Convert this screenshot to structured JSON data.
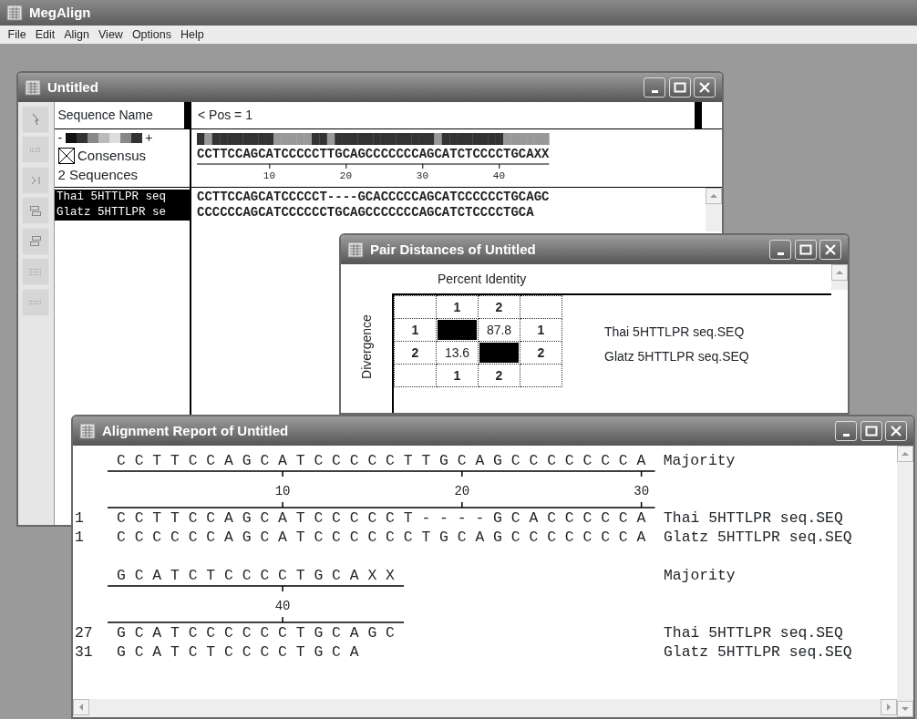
{
  "app": {
    "title": "MegAlign",
    "menu": [
      "File",
      "Edit",
      "Align",
      "View",
      "Options",
      "Help"
    ]
  },
  "alignment_window": {
    "title": "Untitled",
    "name_header": "Sequence Name",
    "position_header": "< Pos = 1",
    "scale_minus": "-",
    "scale_plus": "+",
    "consensus": {
      "checked": true,
      "label": "Consensus",
      "count": "2 Sequences",
      "sequence": "CCTTCCAGCATCCCCCTTGCAGCCCCCCCAGCATCTCCCCTGCAXX",
      "ruler": [
        "10",
        "20",
        "30",
        "40"
      ]
    },
    "sequences": [
      {
        "name": "Thai 5HTTLPR seq",
        "residues": "CCTTCCAGCATCCCCCT----GCACCCCCAGCATCCCCCCTGCAGC",
        "selected": true
      },
      {
        "name": "Glatz 5HTTLPR se",
        "residues": "CCCCCCAGCATCCCCCCTGCAGCCCCCCCAGCATCTCCCCTGCA",
        "selected": true
      }
    ]
  },
  "pair_distances": {
    "title": "Pair Distances of Untitled",
    "top_label": "Percent Identity",
    "side_label": "Divergence",
    "column_headers": [
      "1",
      "2"
    ],
    "column_footers": [
      "1",
      "2"
    ],
    "rows": [
      {
        "label": "1",
        "cells": [
          {
            "kind": "filled"
          },
          {
            "kind": "value",
            "text": "87.8"
          }
        ],
        "end_label": "1",
        "name": "Thai 5HTTLPR seq.SEQ"
      },
      {
        "label": "2",
        "cells": [
          {
            "kind": "value",
            "text": "13.6"
          },
          {
            "kind": "filled"
          }
        ],
        "end_label": "2",
        "name": "Glatz 5HTTLPR seq.SEQ"
      }
    ]
  },
  "report": {
    "title": "Alignment Report of Untitled",
    "blocks": [
      {
        "majority": "C C T T C C A G C A T C C C C C T T G C A G C C C C C C C A",
        "majority_label": "Majority",
        "ruler": [
          "10",
          "20",
          "30"
        ],
        "rows": [
          {
            "number": "1",
            "residues": "C C T T C C A G C A T C C C C C T - - - - G C A C C C C C A",
            "name": "Thai 5HTTLPR seq.SEQ"
          },
          {
            "number": "1",
            "residues": "C C C C C C A G C A T C C C C C C T G C A G C C C C C C C A",
            "name": "Glatz 5HTTLPR seq.SEQ"
          }
        ]
      },
      {
        "majority": "G C A T C T C C C C T G C A X X",
        "majority_label": "Majority",
        "ruler": [
          "40"
        ],
        "rows": [
          {
            "number": "27",
            "residues": "G C A T C C C C C C T G C A G C",
            "name": "Thai 5HTTLPR seq.SEQ"
          },
          {
            "number": "31",
            "residues": "G C A T C T C C C C T G C A",
            "name": "Glatz 5HTTLPR seq.SEQ"
          }
        ]
      }
    ]
  }
}
